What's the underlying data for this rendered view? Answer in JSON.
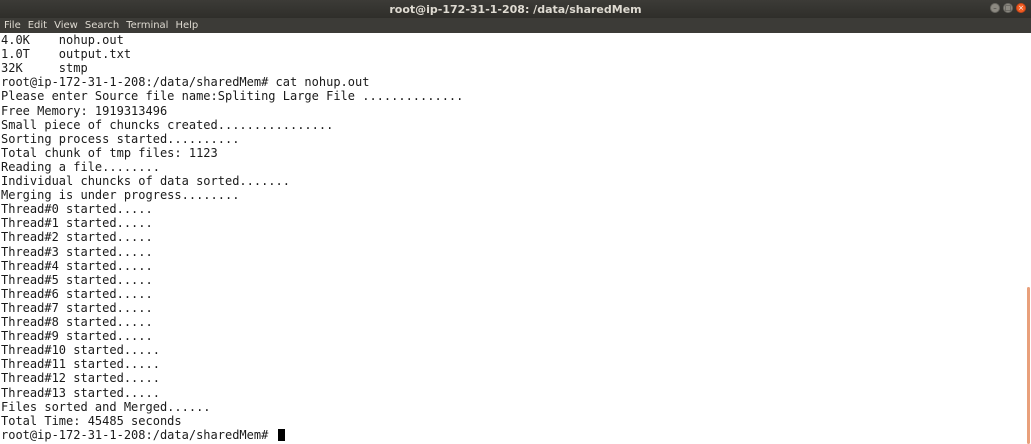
{
  "window": {
    "title": "root@ip-172-31-1-208: /data/sharedMem",
    "controls": [
      "minimize-icon",
      "maximize-icon",
      "close-icon"
    ]
  },
  "menubar": {
    "items": [
      "File",
      "Edit",
      "View",
      "Search",
      "Terminal",
      "Help"
    ]
  },
  "terminal": {
    "lines": [
      "4.0K    nohup.out",
      "1.0T    output.txt",
      "32K     stmp",
      "root@ip-172-31-1-208:/data/sharedMem# cat nohup.out",
      "Please enter Source file name:Spliting Large File ..............",
      "Free Memory: 1919313496",
      "Small piece of chuncks created................",
      "Sorting process started..........",
      "Total chunk of tmp files: 1123",
      "Reading a file........",
      "Individual chuncks of data sorted.......",
      "Merging is under progress........",
      "Thread#0 started.....",
      "Thread#1 started.....",
      "Thread#2 started.....",
      "Thread#3 started.....",
      "Thread#4 started.....",
      "Thread#5 started.....",
      "Thread#6 started.....",
      "Thread#7 started.....",
      "Thread#8 started.....",
      "Thread#9 started.....",
      "Thread#10 started.....",
      "Thread#11 started.....",
      "Thread#12 started.....",
      "Thread#13 started.....",
      "Files sorted and Merged......",
      "Total Time: 45485 seconds"
    ],
    "prompt": "root@ip-172-31-1-208:/data/sharedMem# "
  },
  "colors": {
    "titlebar": "#3c3b37",
    "title_text": "#dfdbd2",
    "terminal_bg": "#ffffff",
    "terminal_text": "#1a1a1a",
    "scroll_thumb": "#e9a07b",
    "close_button": "#f15d22"
  }
}
